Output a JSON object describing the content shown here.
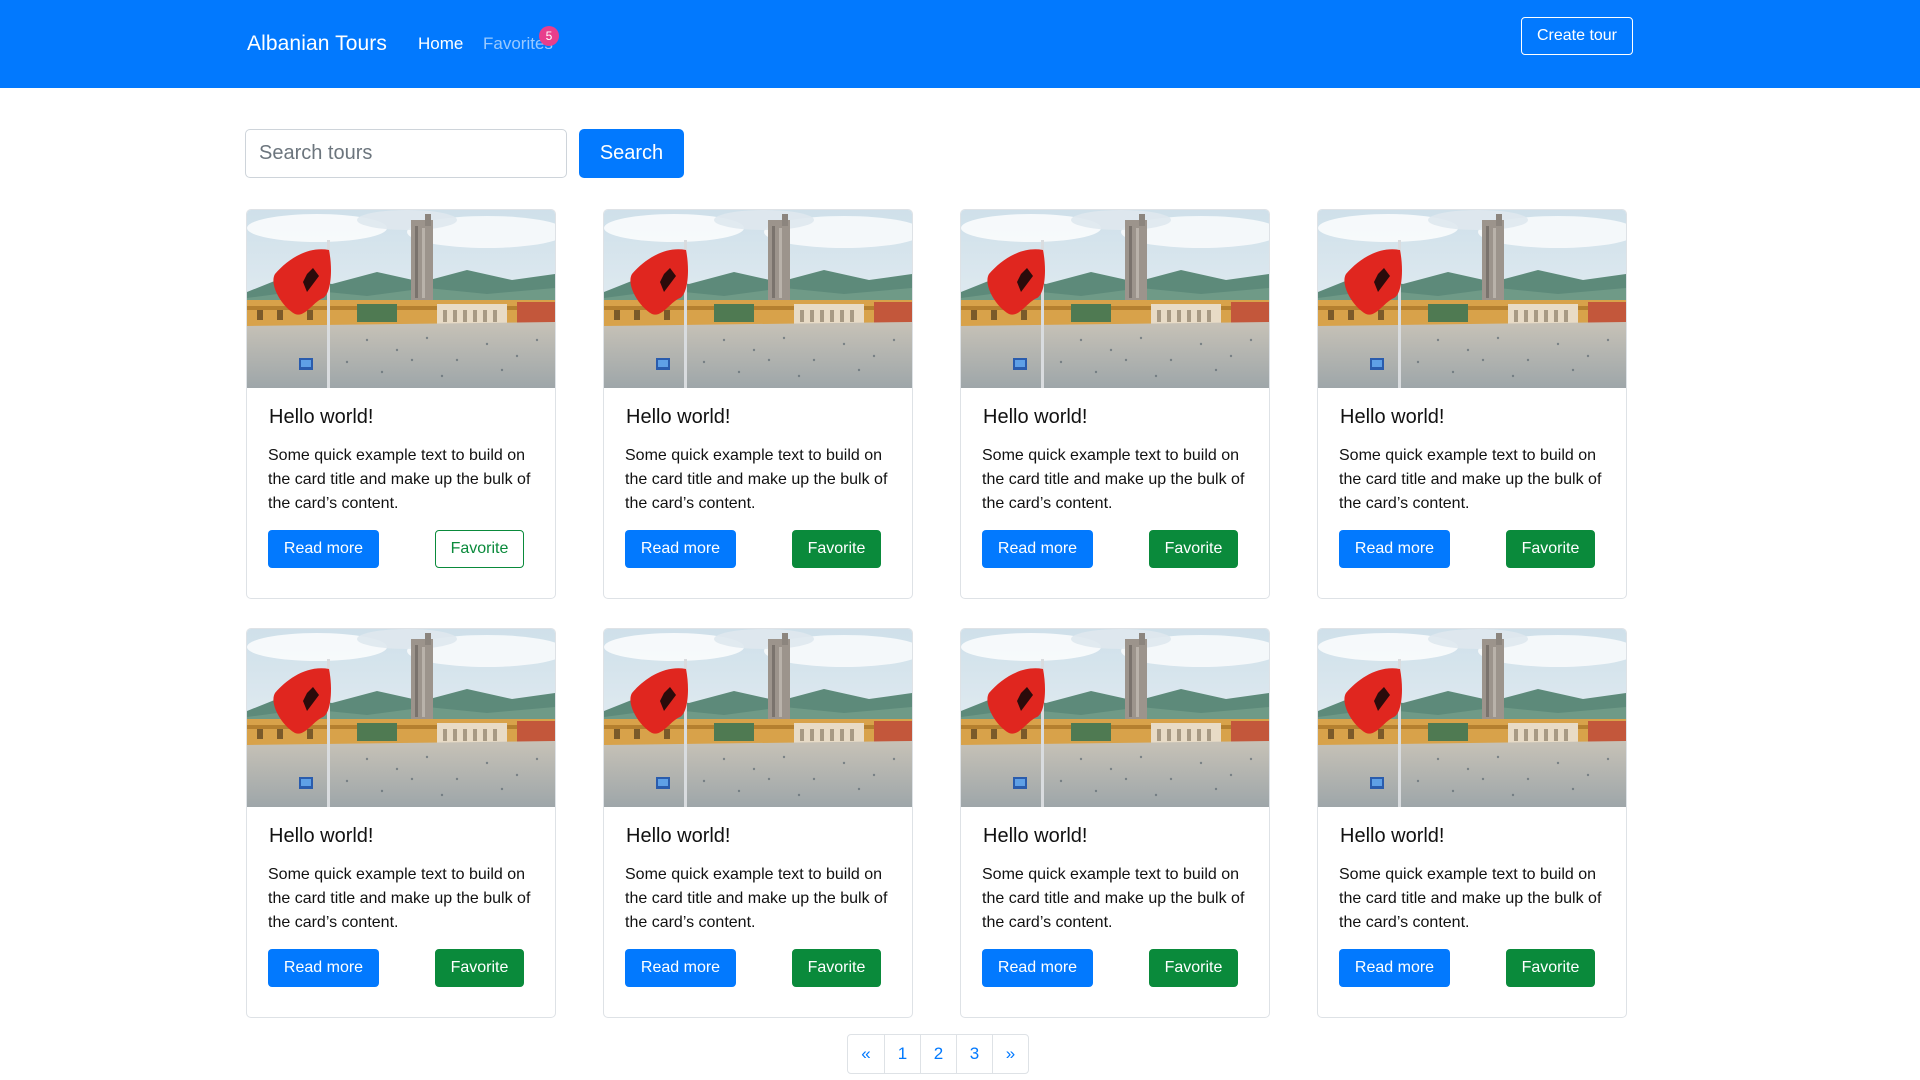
{
  "navbar": {
    "brand": "Albanian Tours",
    "links": {
      "home": "Home",
      "favorites": "Favorites"
    },
    "favorites_count": "5",
    "create_button": "Create tour"
  },
  "search": {
    "placeholder": "Search tours",
    "value": "",
    "button": "Search"
  },
  "cards": [
    {
      "title": "Hello world!",
      "text": "Some quick example text to build on the card title and make up the bulk of the card’s content.",
      "read_more": "Read more",
      "favorite": "Favorite",
      "favorited": false
    },
    {
      "title": "Hello world!",
      "text": "Some quick example text to build on the card title and make up the bulk of the card’s content.",
      "read_more": "Read more",
      "favorite": "Favorite",
      "favorited": true
    },
    {
      "title": "Hello world!",
      "text": "Some quick example text to build on the card title and make up the bulk of the card’s content.",
      "read_more": "Read more",
      "favorite": "Favorite",
      "favorited": true
    },
    {
      "title": "Hello world!",
      "text": "Some quick example text to build on the card title and make up the bulk of the card’s content.",
      "read_more": "Read more",
      "favorite": "Favorite",
      "favorited": true
    },
    {
      "title": "Hello world!",
      "text": "Some quick example text to build on the card title and make up the bulk of the card’s content.",
      "read_more": "Read more",
      "favorite": "Favorite",
      "favorited": true
    },
    {
      "title": "Hello world!",
      "text": "Some quick example text to build on the card title and make up the bulk of the card’s content.",
      "read_more": "Read more",
      "favorite": "Favorite",
      "favorited": true
    },
    {
      "title": "Hello world!",
      "text": "Some quick example text to build on the card title and make up the bulk of the card’s content.",
      "read_more": "Read more",
      "favorite": "Favorite",
      "favorited": true
    },
    {
      "title": "Hello world!",
      "text": "Some quick example text to build on the card title and make up the bulk of the card’s content.",
      "read_more": "Read more",
      "favorite": "Favorite",
      "favorited": true
    }
  ],
  "pagination": {
    "prev": "«",
    "pages": [
      "1",
      "2",
      "3"
    ],
    "next": "»"
  },
  "colors": {
    "primary": "#0279fe",
    "success": "#0a8a3b",
    "badge": "#e83e8c"
  }
}
